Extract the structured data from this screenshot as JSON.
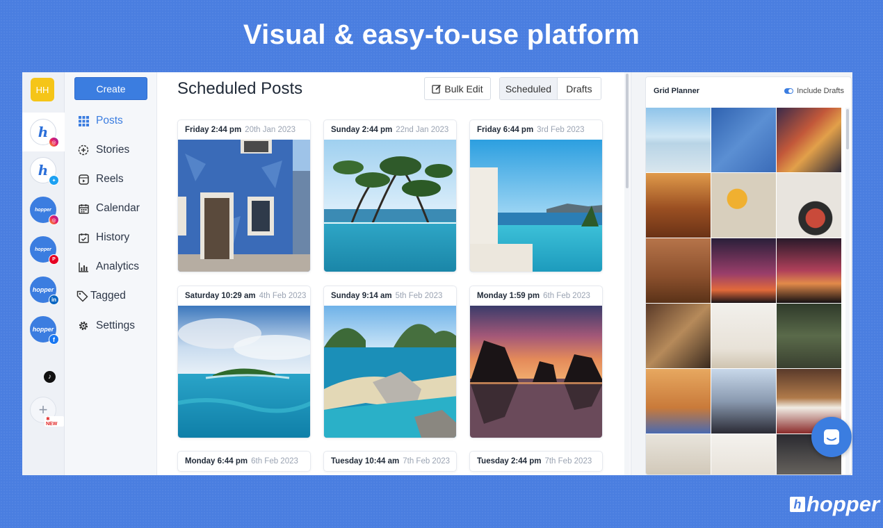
{
  "headline": "Visual & easy-to-use platform",
  "rail": {
    "user_initials": "HH",
    "accounts": [
      {
        "network": "instagram",
        "mark": "h",
        "active": true
      },
      {
        "network": "twitter",
        "mark": "h"
      },
      {
        "network": "instagram",
        "mark": "hopper"
      },
      {
        "network": "pinterest",
        "mark": "hopper"
      },
      {
        "network": "linkedin",
        "mark": "hopper"
      },
      {
        "network": "facebook",
        "mark": "hopper"
      },
      {
        "network": "tiktok"
      }
    ],
    "new_label": "NEW"
  },
  "nav": {
    "create_label": "Create",
    "items": [
      {
        "label": "Posts",
        "icon": "grid-icon",
        "active": true
      },
      {
        "label": "Stories",
        "icon": "stories-icon"
      },
      {
        "label": "Reels",
        "icon": "reels-icon"
      },
      {
        "label": "Calendar",
        "icon": "calendar-icon"
      },
      {
        "label": "History",
        "icon": "history-icon"
      },
      {
        "label": "Analytics",
        "icon": "analytics-icon"
      },
      {
        "label": "Tagged",
        "icon": "tag-icon"
      },
      {
        "label": "Settings",
        "icon": "gear-icon"
      }
    ]
  },
  "main": {
    "title": "Scheduled Posts",
    "bulk_edit_label": "Bulk Edit",
    "tabs": [
      "Scheduled",
      "Drafts"
    ],
    "posts": [
      {
        "time": "Friday 2:44 pm",
        "date": "20th Jan 2023",
        "scene": "blue-house"
      },
      {
        "time": "Sunday 2:44 pm",
        "date": "22nd Jan 2023",
        "scene": "infinity-pool-trees"
      },
      {
        "time": "Friday 6:44 pm",
        "date": "3rd Feb 2023",
        "scene": "pool-sea"
      },
      {
        "time": "Saturday 10:29 am",
        "date": "4th Feb 2023",
        "scene": "island"
      },
      {
        "time": "Sunday 9:14 am",
        "date": "5th Feb 2023",
        "scene": "lagoon-cliffs"
      },
      {
        "time": "Monday 1:59 pm",
        "date": "6th Feb 2023",
        "scene": "sunset-rocks"
      },
      {
        "time": "Monday 6:44 pm",
        "date": "6th Feb 2023",
        "scene": "hidden"
      },
      {
        "time": "Tuesday 10:44 am",
        "date": "7th Feb 2023",
        "scene": "hidden"
      },
      {
        "time": "Tuesday 2:44 pm",
        "date": "7th Feb 2023",
        "scene": "hidden"
      }
    ]
  },
  "grid_planner": {
    "title": "Grid Planner",
    "toggle_label": "Include Drafts",
    "toggle_on": true
  },
  "brand": "hopper",
  "colors": {
    "background": "#4a7ee0",
    "accent": "#3b7de0"
  }
}
